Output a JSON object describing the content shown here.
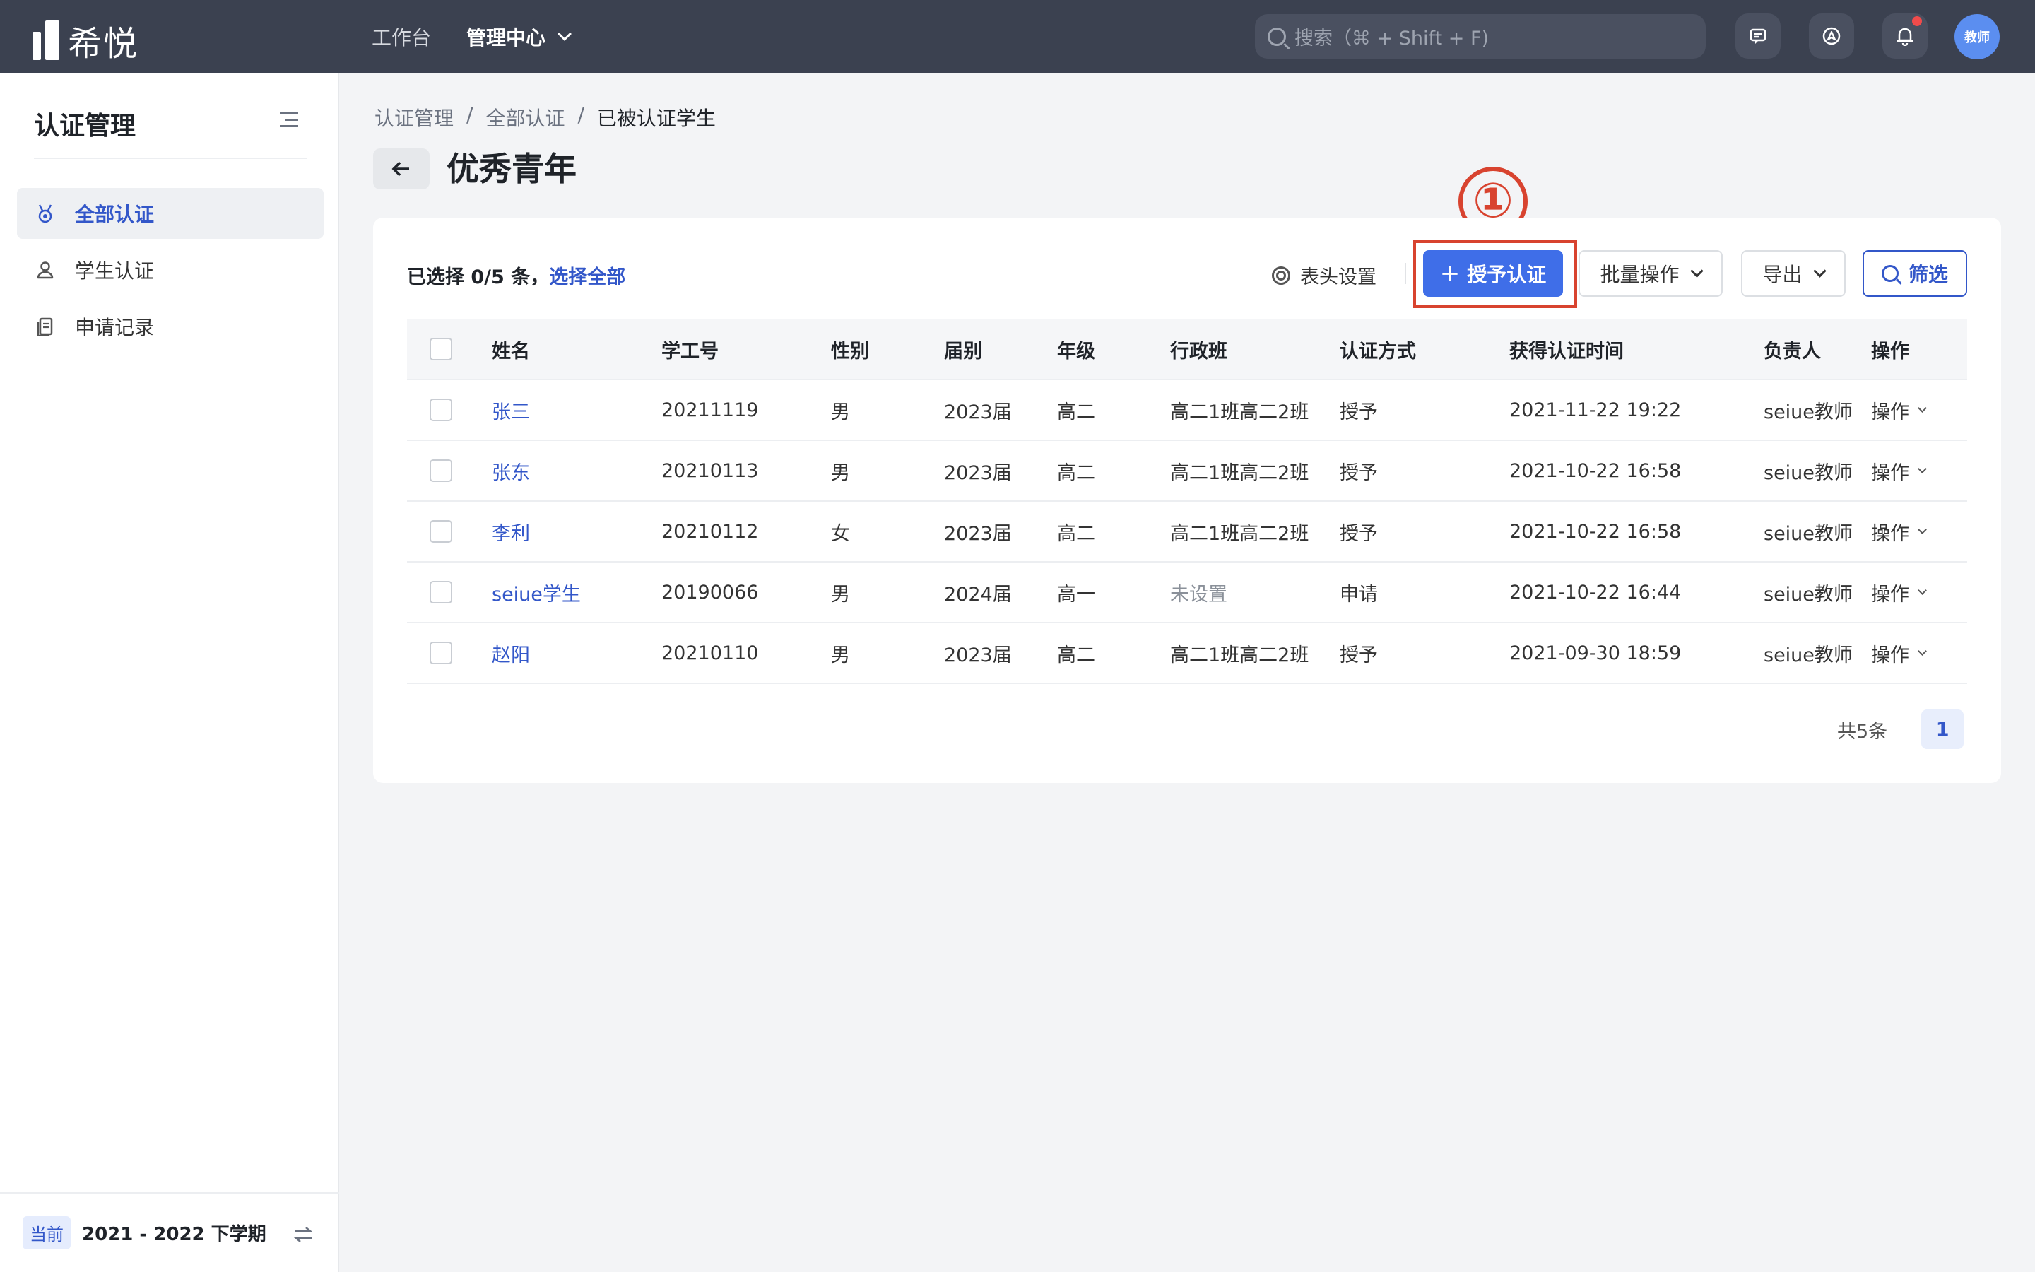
{
  "topbar": {
    "logo_text": "希悦",
    "nav": [
      {
        "label": "工作台"
      },
      {
        "label": "管理中心"
      }
    ],
    "search_placeholder": "搜索（⌘ + Shift + F)",
    "avatar_text": "教师",
    "icons": [
      "message-icon",
      "compass-icon",
      "bell-icon"
    ]
  },
  "sidebar": {
    "title": "认证管理",
    "items": [
      {
        "label": "全部认证",
        "icon": "medal-icon",
        "active": true
      },
      {
        "label": "学生认证",
        "icon": "person-icon",
        "active": false
      },
      {
        "label": "申请记录",
        "icon": "document-icon",
        "active": false
      }
    ],
    "footer": {
      "badge": "当前",
      "term": "2021 - 2022 下学期"
    }
  },
  "breadcrumb": [
    "认证管理",
    "/",
    "全部认证",
    "/",
    "已被认证学生"
  ],
  "page_title": "优秀青年",
  "annotation": "①",
  "toolbar": {
    "selection_prefix": "已选择 0/5 条，",
    "select_all": "选择全部",
    "header_settings": "表头设置",
    "grant_label": "授予认证",
    "batch_label": "批量操作",
    "export_label": "导出",
    "filter_label": "筛选"
  },
  "table": {
    "columns": [
      "姓名",
      "学工号",
      "性别",
      "届别",
      "年级",
      "行政班",
      "认证方式",
      "获得认证时间",
      "负责人",
      "操作"
    ],
    "rows": [
      {
        "name": "张三",
        "id": "20211119",
        "gender": "男",
        "cohort": "2023届",
        "grade": "高二",
        "class": "高二1班高二2班",
        "method": "授予",
        "time": "2021-11-22 19:22",
        "owner": "seiue教师",
        "op": "操作"
      },
      {
        "name": "张东",
        "id": "20210113",
        "gender": "男",
        "cohort": "2023届",
        "grade": "高二",
        "class": "高二1班高二2班",
        "method": "授予",
        "time": "2021-10-22 16:58",
        "owner": "seiue教师",
        "op": "操作"
      },
      {
        "name": "李利",
        "id": "20210112",
        "gender": "女",
        "cohort": "2023届",
        "grade": "高二",
        "class": "高二1班高二2班",
        "method": "授予",
        "time": "2021-10-22 16:58",
        "owner": "seiue教师",
        "op": "操作"
      },
      {
        "name": "seiue学生",
        "id": "20190066",
        "gender": "男",
        "cohort": "2024届",
        "grade": "高一",
        "class": "未设置",
        "method": "申请",
        "time": "2021-10-22 16:44",
        "owner": "seiue教师",
        "op": "操作"
      },
      {
        "name": "赵阳",
        "id": "20210110",
        "gender": "男",
        "cohort": "2023届",
        "grade": "高二",
        "class": "高二1班高二2班",
        "method": "授予",
        "time": "2021-09-30 18:59",
        "owner": "seiue教师",
        "op": "操作"
      }
    ]
  },
  "pagination": {
    "total": "共5条",
    "current": "1"
  },
  "colors": {
    "topbar": "#3b4150",
    "accent": "#3f6ee8",
    "link": "#3357c9",
    "annotation": "#d8432f"
  }
}
